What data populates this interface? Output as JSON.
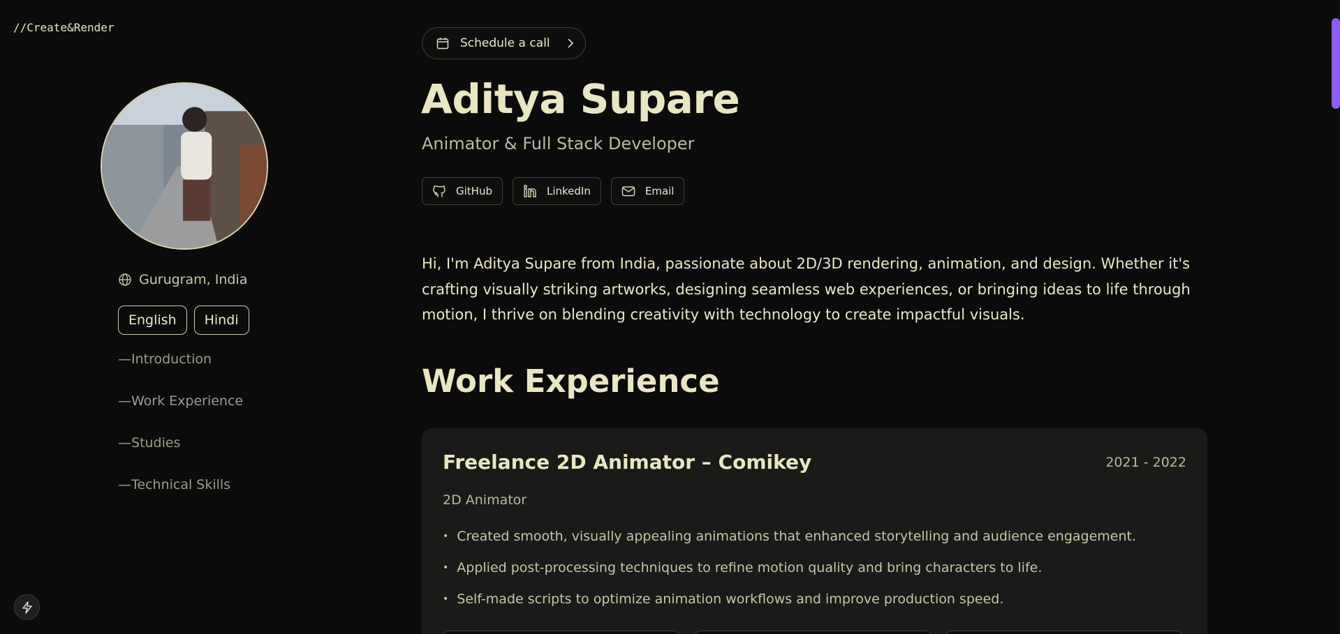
{
  "brand": "//Create&Render",
  "profile": {
    "location": "Gurugram, India",
    "languages": [
      "English",
      "Hindi"
    ]
  },
  "toc": [
    "—Introduction",
    "—Work Experience",
    "—Studies",
    "—Technical Skills"
  ],
  "header": {
    "schedule_label": "Schedule a call",
    "name": "Aditya Supare",
    "role": "Animator & Full Stack Developer",
    "socials": [
      {
        "label": "GitHub",
        "icon": "github-icon"
      },
      {
        "label": "LinkedIn",
        "icon": "linkedin-icon"
      },
      {
        "label": "Email",
        "icon": "email-icon"
      }
    ]
  },
  "intro": "Hi, I'm Aditya Supare from India, passionate about 2D/3D rendering, animation, and design. Whether it's crafting visually striking artworks, designing seamless web experiences, or bringing ideas to life through motion, I thrive on blending creativity with technology to create impactful visuals.",
  "work": {
    "title": "Work Experience",
    "jobs": [
      {
        "title": "Freelance 2D Animator – Comikey",
        "years": "2021 - 2022",
        "role": "2D Animator",
        "bullets": [
          "Created smooth, visually appealing animations that enhanced storytelling and audience engagement.",
          "Applied post-processing techniques to refine motion quality and bring characters to life.",
          "Self-made scripts to optimize animation workflows and improve production speed."
        ]
      }
    ]
  },
  "colors": {
    "background": "#0b0b0b",
    "text": "#e9e6c4",
    "card": "#1a1a18",
    "accent": "#8b5cf6"
  }
}
